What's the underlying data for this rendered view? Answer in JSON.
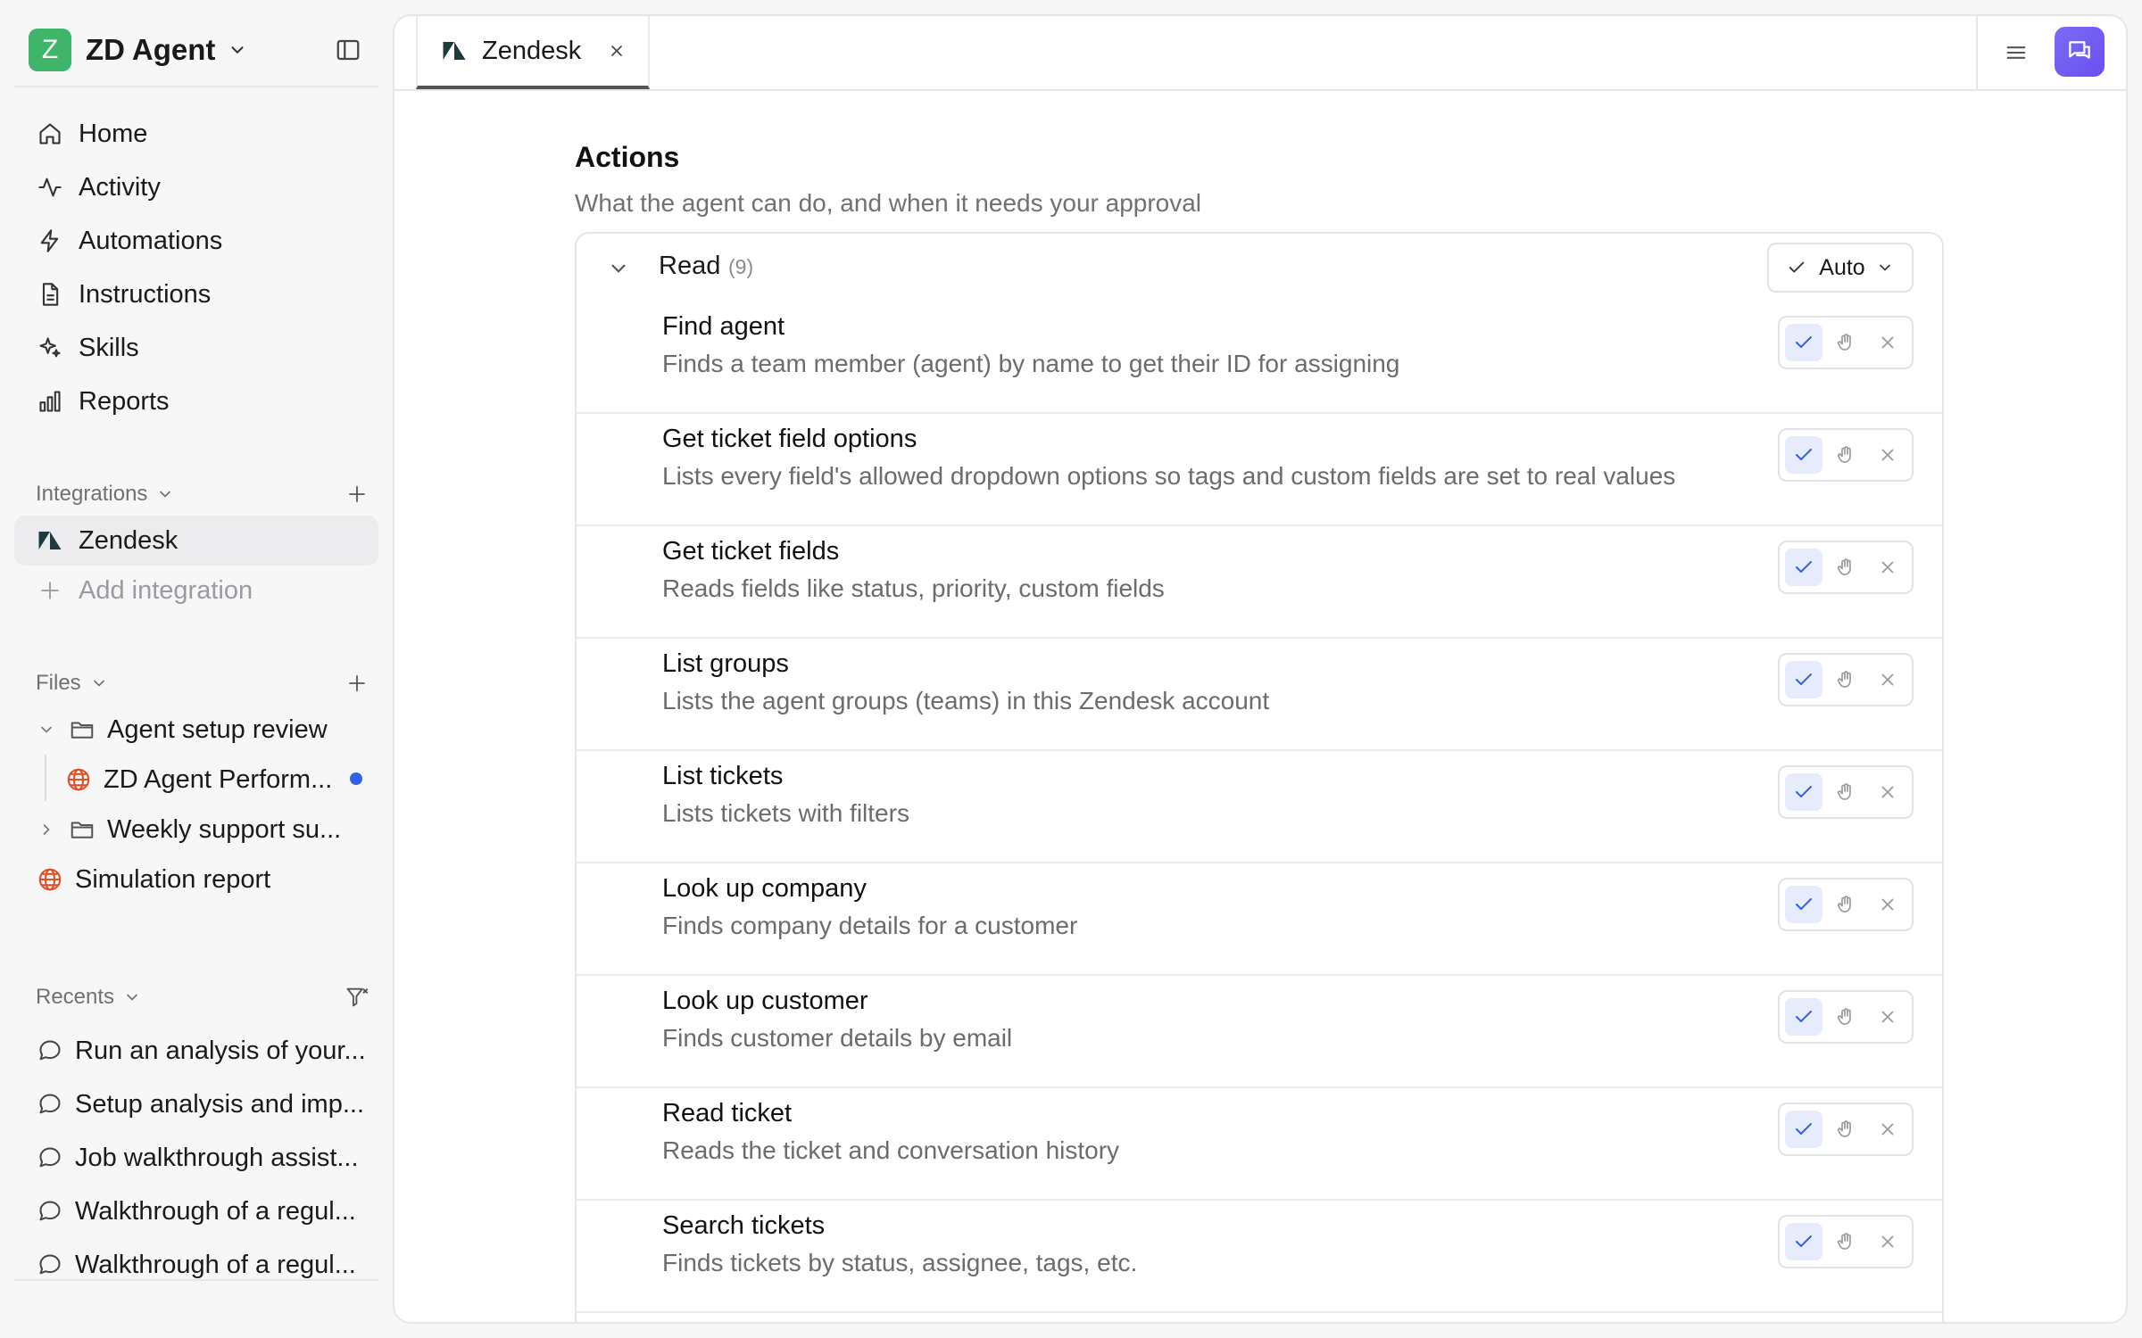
{
  "workspace": {
    "logo_letter": "Z",
    "name": "ZD Agent"
  },
  "nav": [
    {
      "label": "Home",
      "icon": "home-icon"
    },
    {
      "label": "Activity",
      "icon": "activity-icon"
    },
    {
      "label": "Automations",
      "icon": "lightning-icon"
    },
    {
      "label": "Instructions",
      "icon": "document-icon"
    },
    {
      "label": "Skills",
      "icon": "sparkle-icon"
    },
    {
      "label": "Reports",
      "icon": "bar-chart-icon"
    }
  ],
  "integrations": {
    "header": "Integrations",
    "items": [
      {
        "label": "Zendesk",
        "active": true
      }
    ],
    "add_label": "Add integration"
  },
  "files": {
    "header": "Files",
    "tree": [
      {
        "label": "Agent setup review",
        "type": "folder",
        "expanded": true
      },
      {
        "label": "ZD Agent Perform...",
        "type": "web",
        "unread": true
      },
      {
        "label": "Weekly support su...",
        "type": "folder",
        "expanded": false
      },
      {
        "label": "Simulation report",
        "type": "web"
      }
    ]
  },
  "recents": {
    "header": "Recents",
    "items": [
      "Run an analysis of your...",
      "Setup analysis and imp...",
      "Job walkthrough assist...",
      "Walkthrough of a regul...",
      "Walkthrough of a regul..."
    ]
  },
  "tabs": [
    {
      "label": "Zendesk",
      "active": true
    }
  ],
  "actions_section": {
    "title": "Actions",
    "subtitle": "What the agent can do, and when it needs your approval",
    "group": {
      "label": "Read",
      "count": "(9)",
      "mode": "Auto"
    },
    "items": [
      {
        "name": "Find agent",
        "desc": "Finds a team member (agent) by name to get their ID for assigning",
        "permission": "allow"
      },
      {
        "name": "Get ticket field options",
        "desc": "Lists every field's allowed dropdown options so tags and custom fields are set to real values",
        "permission": "allow"
      },
      {
        "name": "Get ticket fields",
        "desc": "Reads fields like status, priority, custom fields",
        "permission": "allow"
      },
      {
        "name": "List groups",
        "desc": "Lists the agent groups (teams) in this Zendesk account",
        "permission": "allow"
      },
      {
        "name": "List tickets",
        "desc": "Lists tickets with filters",
        "permission": "allow"
      },
      {
        "name": "Look up company",
        "desc": "Finds company details for a customer",
        "permission": "allow"
      },
      {
        "name": "Look up customer",
        "desc": "Finds customer details by email",
        "permission": "allow"
      },
      {
        "name": "Read ticket",
        "desc": "Reads the ticket and conversation history",
        "permission": "allow"
      },
      {
        "name": "Search tickets",
        "desc": "Finds tickets by status, assignee, tags, etc.",
        "permission": "allow"
      }
    ]
  },
  "colors": {
    "logo_green": "#3fb56a",
    "accent_blue": "#3360e8",
    "chat_purple": "#6a4ff0",
    "web_orange": "#e0502a"
  }
}
